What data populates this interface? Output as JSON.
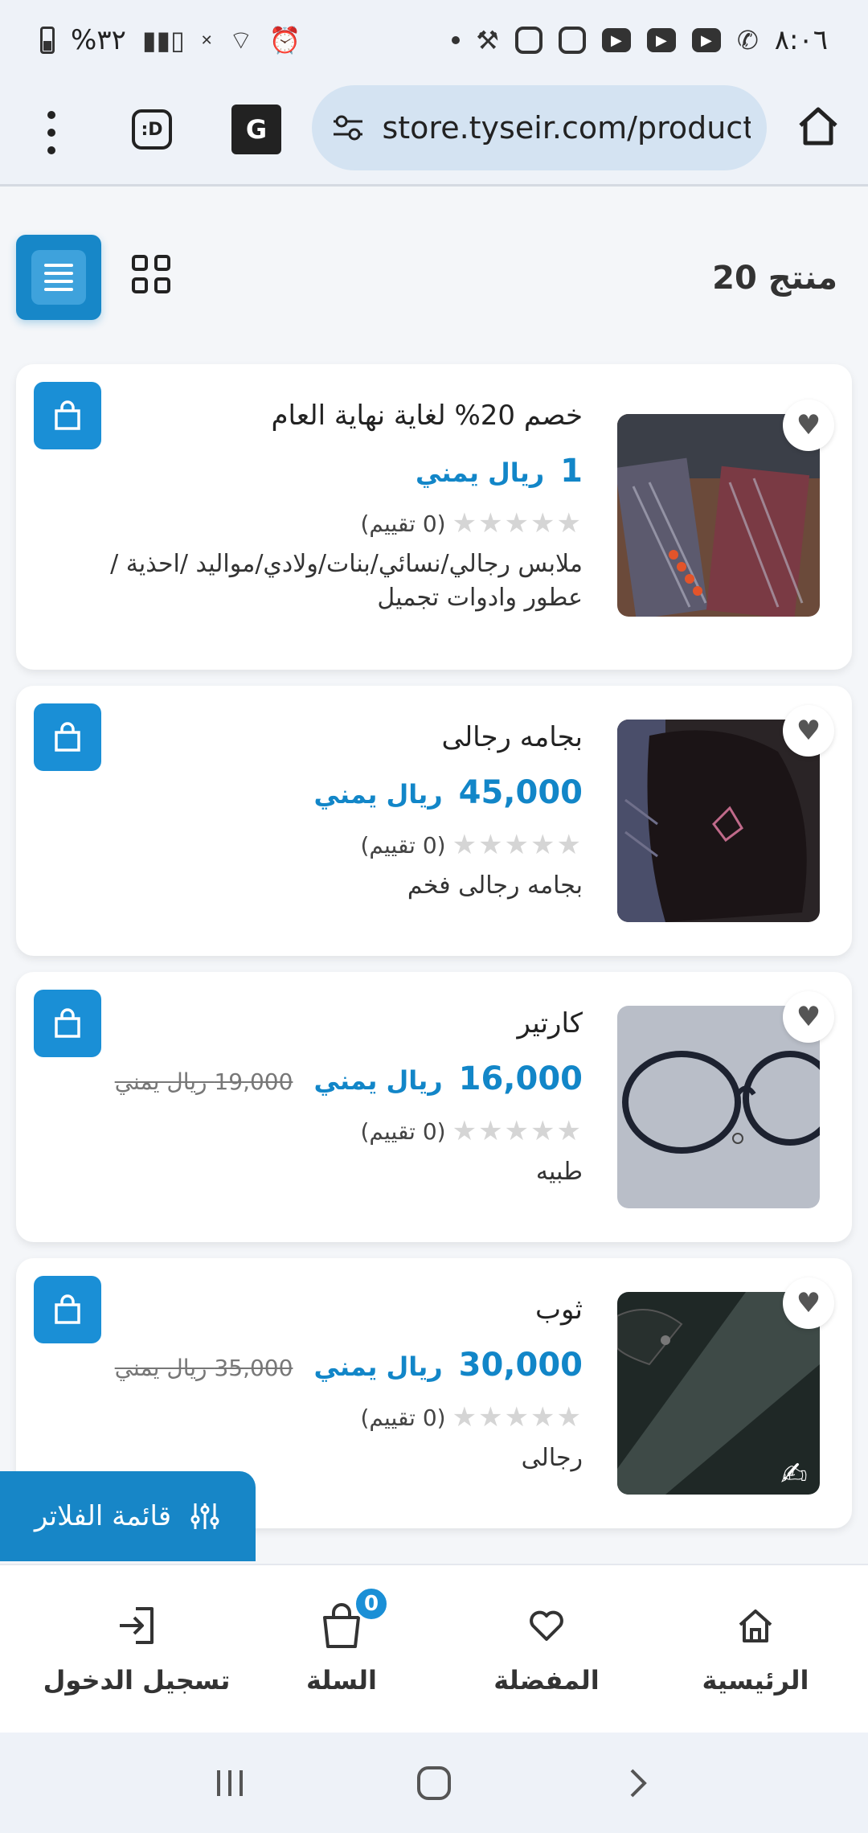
{
  "status": {
    "time": "٨:٠٦",
    "battery": "%٣٢"
  },
  "browser": {
    "url": "store.tyseir.com/product",
    "ext_label": ":D"
  },
  "list": {
    "count_label": "20 منتج"
  },
  "products": [
    {
      "title": "خصم 20% لغاية نهاية العام",
      "price": "1",
      "currency": "ريال يمني",
      "old_price": "",
      "rating": "(0 تقييم)",
      "description": "ملابس رجالي/نسائي/بنات/ولادي/مواليد /احذية / عطور وادوات تجميل"
    },
    {
      "title": "بجامه رجالى",
      "price": "45,000",
      "currency": "ريال يمني",
      "old_price": "",
      "rating": "(0 تقييم)",
      "description": "بجامه رجالى فخم"
    },
    {
      "title": "كارتير",
      "price": "16,000",
      "currency": "ريال يمني",
      "old_price": "19,000 ريال يمني",
      "rating": "(0 تقييم)",
      "description": "طبيه"
    },
    {
      "title": "ثوب",
      "price": "30,000",
      "currency": "ريال يمني",
      "old_price": "35,000 ريال يمني",
      "rating": "(0 تقييم)",
      "description": "رجالى"
    }
  ],
  "filter": {
    "label": "قائمة الفلاتر"
  },
  "bottom_nav": {
    "home": "الرئيسية",
    "favorites": "المفضلة",
    "cart": "السلة",
    "cart_count": "0",
    "login": "تسجيل الدخول"
  },
  "colors": {
    "accent": "#1a8fd6",
    "price": "#1286c8"
  }
}
